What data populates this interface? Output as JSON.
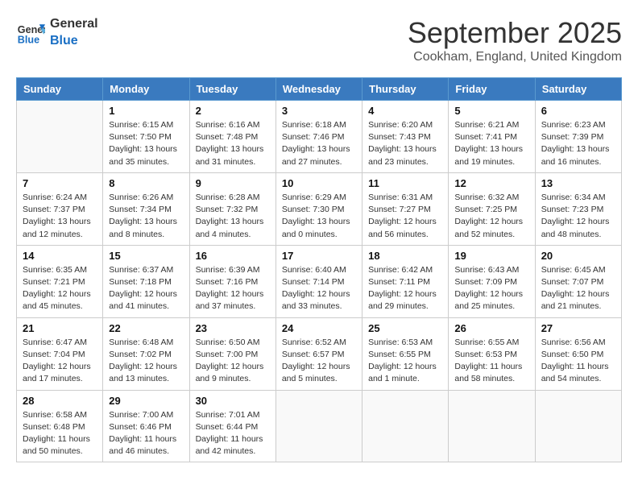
{
  "logo": {
    "line1": "General",
    "line2": "Blue"
  },
  "title": "September 2025",
  "location": "Cookham, England, United Kingdom",
  "days_of_week": [
    "Sunday",
    "Monday",
    "Tuesday",
    "Wednesday",
    "Thursday",
    "Friday",
    "Saturday"
  ],
  "weeks": [
    [
      {
        "day": "",
        "info": ""
      },
      {
        "day": "1",
        "info": "Sunrise: 6:15 AM\nSunset: 7:50 PM\nDaylight: 13 hours\nand 35 minutes."
      },
      {
        "day": "2",
        "info": "Sunrise: 6:16 AM\nSunset: 7:48 PM\nDaylight: 13 hours\nand 31 minutes."
      },
      {
        "day": "3",
        "info": "Sunrise: 6:18 AM\nSunset: 7:46 PM\nDaylight: 13 hours\nand 27 minutes."
      },
      {
        "day": "4",
        "info": "Sunrise: 6:20 AM\nSunset: 7:43 PM\nDaylight: 13 hours\nand 23 minutes."
      },
      {
        "day": "5",
        "info": "Sunrise: 6:21 AM\nSunset: 7:41 PM\nDaylight: 13 hours\nand 19 minutes."
      },
      {
        "day": "6",
        "info": "Sunrise: 6:23 AM\nSunset: 7:39 PM\nDaylight: 13 hours\nand 16 minutes."
      }
    ],
    [
      {
        "day": "7",
        "info": "Sunrise: 6:24 AM\nSunset: 7:37 PM\nDaylight: 13 hours\nand 12 minutes."
      },
      {
        "day": "8",
        "info": "Sunrise: 6:26 AM\nSunset: 7:34 PM\nDaylight: 13 hours\nand 8 minutes."
      },
      {
        "day": "9",
        "info": "Sunrise: 6:28 AM\nSunset: 7:32 PM\nDaylight: 13 hours\nand 4 minutes."
      },
      {
        "day": "10",
        "info": "Sunrise: 6:29 AM\nSunset: 7:30 PM\nDaylight: 13 hours\nand 0 minutes."
      },
      {
        "day": "11",
        "info": "Sunrise: 6:31 AM\nSunset: 7:27 PM\nDaylight: 12 hours\nand 56 minutes."
      },
      {
        "day": "12",
        "info": "Sunrise: 6:32 AM\nSunset: 7:25 PM\nDaylight: 12 hours\nand 52 minutes."
      },
      {
        "day": "13",
        "info": "Sunrise: 6:34 AM\nSunset: 7:23 PM\nDaylight: 12 hours\nand 48 minutes."
      }
    ],
    [
      {
        "day": "14",
        "info": "Sunrise: 6:35 AM\nSunset: 7:21 PM\nDaylight: 12 hours\nand 45 minutes."
      },
      {
        "day": "15",
        "info": "Sunrise: 6:37 AM\nSunset: 7:18 PM\nDaylight: 12 hours\nand 41 minutes."
      },
      {
        "day": "16",
        "info": "Sunrise: 6:39 AM\nSunset: 7:16 PM\nDaylight: 12 hours\nand 37 minutes."
      },
      {
        "day": "17",
        "info": "Sunrise: 6:40 AM\nSunset: 7:14 PM\nDaylight: 12 hours\nand 33 minutes."
      },
      {
        "day": "18",
        "info": "Sunrise: 6:42 AM\nSunset: 7:11 PM\nDaylight: 12 hours\nand 29 minutes."
      },
      {
        "day": "19",
        "info": "Sunrise: 6:43 AM\nSunset: 7:09 PM\nDaylight: 12 hours\nand 25 minutes."
      },
      {
        "day": "20",
        "info": "Sunrise: 6:45 AM\nSunset: 7:07 PM\nDaylight: 12 hours\nand 21 minutes."
      }
    ],
    [
      {
        "day": "21",
        "info": "Sunrise: 6:47 AM\nSunset: 7:04 PM\nDaylight: 12 hours\nand 17 minutes."
      },
      {
        "day": "22",
        "info": "Sunrise: 6:48 AM\nSunset: 7:02 PM\nDaylight: 12 hours\nand 13 minutes."
      },
      {
        "day": "23",
        "info": "Sunrise: 6:50 AM\nSunset: 7:00 PM\nDaylight: 12 hours\nand 9 minutes."
      },
      {
        "day": "24",
        "info": "Sunrise: 6:52 AM\nSunset: 6:57 PM\nDaylight: 12 hours\nand 5 minutes."
      },
      {
        "day": "25",
        "info": "Sunrise: 6:53 AM\nSunset: 6:55 PM\nDaylight: 12 hours\nand 1 minute."
      },
      {
        "day": "26",
        "info": "Sunrise: 6:55 AM\nSunset: 6:53 PM\nDaylight: 11 hours\nand 58 minutes."
      },
      {
        "day": "27",
        "info": "Sunrise: 6:56 AM\nSunset: 6:50 PM\nDaylight: 11 hours\nand 54 minutes."
      }
    ],
    [
      {
        "day": "28",
        "info": "Sunrise: 6:58 AM\nSunset: 6:48 PM\nDaylight: 11 hours\nand 50 minutes."
      },
      {
        "day": "29",
        "info": "Sunrise: 7:00 AM\nSunset: 6:46 PM\nDaylight: 11 hours\nand 46 minutes."
      },
      {
        "day": "30",
        "info": "Sunrise: 7:01 AM\nSunset: 6:44 PM\nDaylight: 11 hours\nand 42 minutes."
      },
      {
        "day": "",
        "info": ""
      },
      {
        "day": "",
        "info": ""
      },
      {
        "day": "",
        "info": ""
      },
      {
        "day": "",
        "info": ""
      }
    ]
  ]
}
